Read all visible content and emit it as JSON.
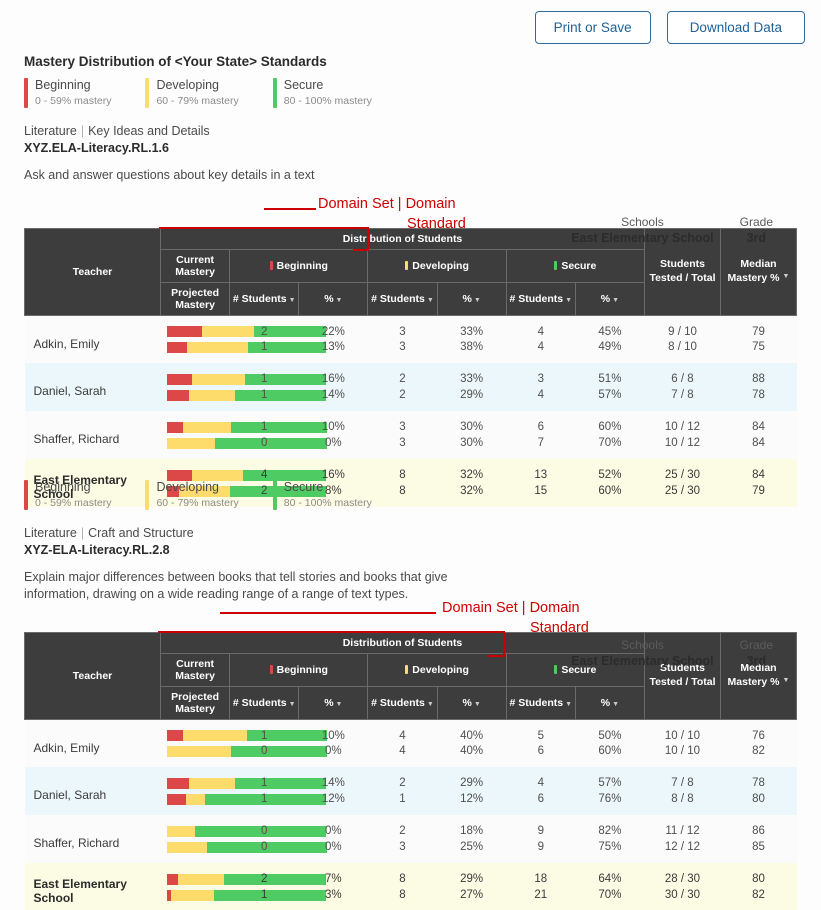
{
  "toolbar": {
    "print_label": "Print or Save",
    "download_label": "Download Data"
  },
  "mastery_title": "Mastery Distribution of <Your State> Standards",
  "legend": [
    {
      "name": "Beginning",
      "range": "0 - 59% mastery",
      "color": "#dc4747"
    },
    {
      "name": "Developing",
      "range": "60 - 79% mastery",
      "color": "#fddc6c"
    },
    {
      "name": "Secure",
      "range": "80 - 100% mastery",
      "color": "#4fcb63"
    }
  ],
  "annotations": {
    "domain_set_domain": "Domain Set | Domain",
    "standard": "Standard"
  },
  "school_grade": {
    "schools_label": "Schools",
    "schools_value": "East Elementary School",
    "grade_label": "Grade",
    "grade_value": "3rd"
  },
  "table_headers": {
    "teacher": "Teacher",
    "distribution": "Distribution of Students",
    "current_mastery": "Current Mastery",
    "projected_mastery": "Projected Mastery",
    "beginning": "Beginning",
    "developing": "Developing",
    "secure": "Secure",
    "num_students": "# Students",
    "percent": "%",
    "students_tested_1": "Students",
    "students_tested_2": "Tested / Total",
    "median_1": "Median",
    "median_2": "Mastery %"
  },
  "sections": [
    {
      "domain_set": "Literature",
      "domain": "Key Ideas and Details",
      "standard_code": "XYZ.ELA-Literacy.RL.1.6",
      "standard_desc": "Ask and answer questions about key details in a text",
      "rows": [
        {
          "teacher": "Adkin, Emily",
          "style": "rowA",
          "current": {
            "beg_n": "2",
            "beg_p": "22%",
            "dev_n": "3",
            "dev_p": "33%",
            "sec_n": "4",
            "sec_p": "45%",
            "tested": "9 / 10",
            "median": "79",
            "bar": [
              22,
              33,
              45
            ]
          },
          "projected": {
            "beg_n": "1",
            "beg_p": "13%",
            "dev_n": "3",
            "dev_p": "38%",
            "sec_n": "4",
            "sec_p": "49%",
            "tested": "8 / 10",
            "median": "75",
            "bar": [
              13,
              38,
              49
            ]
          }
        },
        {
          "teacher": "Daniel, Sarah",
          "style": "rowB",
          "current": {
            "beg_n": "1",
            "beg_p": "16%",
            "dev_n": "2",
            "dev_p": "33%",
            "sec_n": "3",
            "sec_p": "51%",
            "tested": "6 / 8",
            "median": "88",
            "bar": [
              16,
              33,
              51
            ]
          },
          "projected": {
            "beg_n": "1",
            "beg_p": "14%",
            "dev_n": "2",
            "dev_p": "29%",
            "sec_n": "4",
            "sec_p": "57%",
            "tested": "7 / 8",
            "median": "78",
            "bar": [
              14,
              29,
              57
            ]
          }
        },
        {
          "teacher": "Shaffer, Richard",
          "style": "rowA",
          "current": {
            "beg_n": "1",
            "beg_p": "10%",
            "dev_n": "3",
            "dev_p": "30%",
            "sec_n": "6",
            "sec_p": "60%",
            "tested": "10 / 12",
            "median": "84",
            "bar": [
              10,
              30,
              60
            ]
          },
          "projected": {
            "beg_n": "0",
            "beg_p": "0%",
            "dev_n": "3",
            "dev_p": "30%",
            "sec_n": "7",
            "sec_p": "70%",
            "tested": "10 / 12",
            "median": "84",
            "bar": [
              0,
              30,
              70
            ]
          }
        },
        {
          "teacher": "East Elementary School",
          "style": "rowTot",
          "current": {
            "beg_n": "4",
            "beg_p": "16%",
            "dev_n": "8",
            "dev_p": "32%",
            "sec_n": "13",
            "sec_p": "52%",
            "tested": "25 / 30",
            "median": "84",
            "bar": [
              16,
              32,
              52
            ]
          },
          "projected": {
            "beg_n": "2",
            "beg_p": "8%",
            "dev_n": "8",
            "dev_p": "32%",
            "sec_n": "15",
            "sec_p": "60%",
            "tested": "25 / 30",
            "median": "79",
            "bar": [
              8,
              32,
              60
            ]
          }
        }
      ]
    },
    {
      "domain_set": "Literature",
      "domain": "Craft and Structure",
      "standard_code": "XYZ-ELA-Literacy.RL.2.8",
      "standard_desc": "Explain major differences between books that tell stories and books that give information, drawing on a wide reading range of a range of text types.",
      "rows": [
        {
          "teacher": "Adkin, Emily",
          "style": "rowA",
          "current": {
            "beg_n": "1",
            "beg_p": "10%",
            "dev_n": "4",
            "dev_p": "40%",
            "sec_n": "5",
            "sec_p": "50%",
            "tested": "10 / 10",
            "median": "76",
            "bar": [
              10,
              40,
              50
            ]
          },
          "projected": {
            "beg_n": "0",
            "beg_p": "0%",
            "dev_n": "4",
            "dev_p": "40%",
            "sec_n": "6",
            "sec_p": "60%",
            "tested": "10 / 10",
            "median": "82",
            "bar": [
              0,
              40,
              60
            ]
          }
        },
        {
          "teacher": "Daniel, Sarah",
          "style": "rowB",
          "current": {
            "beg_n": "1",
            "beg_p": "14%",
            "dev_n": "2",
            "dev_p": "29%",
            "sec_n": "4",
            "sec_p": "57%",
            "tested": "7 / 8",
            "median": "78",
            "bar": [
              14,
              29,
              57
            ]
          },
          "projected": {
            "beg_n": "1",
            "beg_p": "12%",
            "dev_n": "1",
            "dev_p": "12%",
            "sec_n": "6",
            "sec_p": "76%",
            "tested": "8 / 8",
            "median": "80",
            "bar": [
              12,
              12,
              76
            ]
          }
        },
        {
          "teacher": "Shaffer, Richard",
          "style": "rowA",
          "current": {
            "beg_n": "0",
            "beg_p": "0%",
            "dev_n": "2",
            "dev_p": "18%",
            "sec_n": "9",
            "sec_p": "82%",
            "tested": "11 / 12",
            "median": "86",
            "bar": [
              0,
              18,
              82
            ]
          },
          "projected": {
            "beg_n": "0",
            "beg_p": "0%",
            "dev_n": "3",
            "dev_p": "25%",
            "sec_n": "9",
            "sec_p": "75%",
            "tested": "12 / 12",
            "median": "85",
            "bar": [
              0,
              25,
              75
            ]
          }
        },
        {
          "teacher": "East Elementary School",
          "style": "rowTot",
          "current": {
            "beg_n": "2",
            "beg_p": "7%",
            "dev_n": "8",
            "dev_p": "29%",
            "sec_n": "18",
            "sec_p": "64%",
            "tested": "28 / 30",
            "median": "80",
            "bar": [
              7,
              29,
              64
            ]
          },
          "projected": {
            "beg_n": "1",
            "beg_p": "3%",
            "dev_n": "8",
            "dev_p": "27%",
            "sec_n": "21",
            "sec_p": "70%",
            "tested": "30 / 30",
            "median": "82",
            "bar": [
              3,
              27,
              70
            ]
          }
        }
      ]
    }
  ]
}
